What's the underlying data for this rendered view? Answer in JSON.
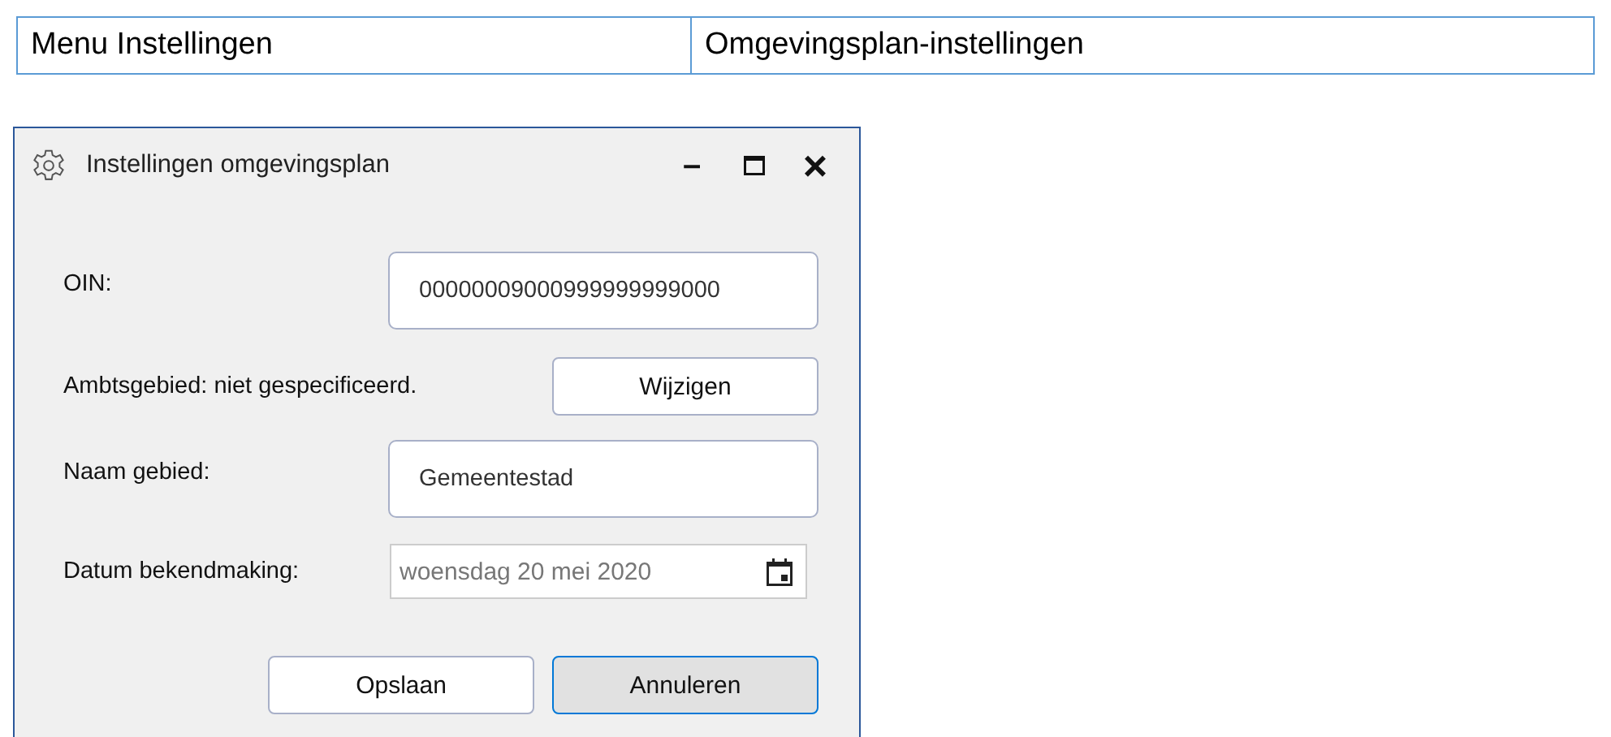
{
  "header_table": {
    "cells": [
      "Menu Instellingen",
      "Omgevingsplan-instellingen"
    ]
  },
  "dialog": {
    "title": "Instellingen omgevingsplan",
    "title_controls": [
      "–",
      "×"
    ],
    "oin": {
      "label": "OIN:",
      "value": "00000009000999999999000"
    },
    "ambtsgebied": {
      "label": "Ambtsgebied: niet gespecificeerd.",
      "button": "Wijzigen"
    },
    "naam": {
      "label": "Naam gebied:",
      "value": "Gemeentestad"
    },
    "datum": {
      "label": "Datum bekendmaking:",
      "value": "woensdag 20 mei 2020",
      "disabled": true
    },
    "buttons": [
      {
        "label": "Opslaan",
        "focused": false
      },
      {
        "label": "Annuleren",
        "focused": true
      }
    ]
  }
}
